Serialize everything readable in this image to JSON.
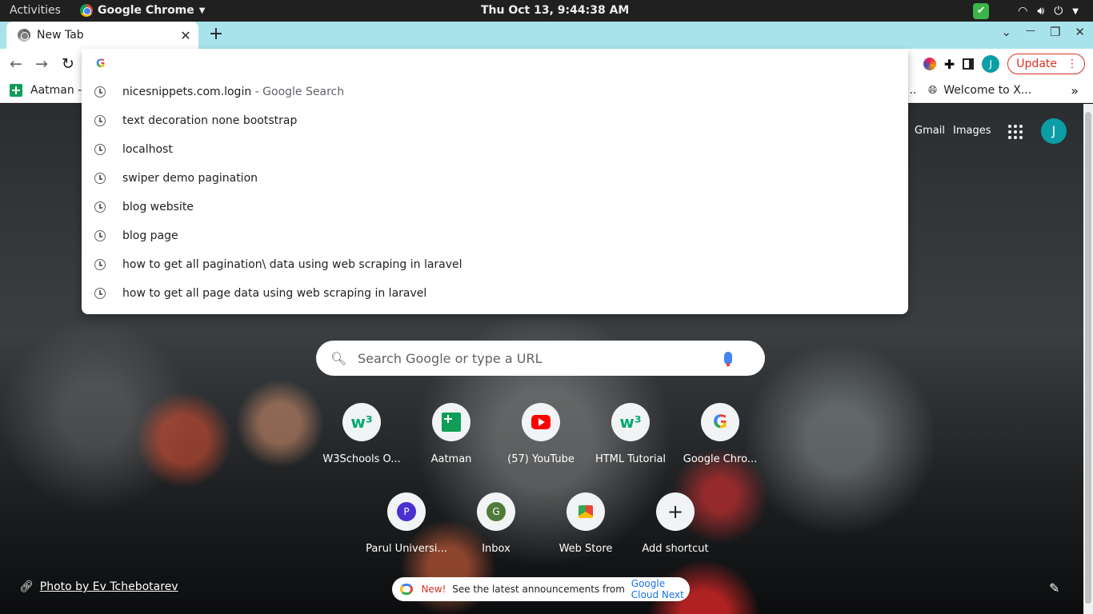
{
  "os_bar": {
    "activities": "Activities",
    "app_name": "Google Chrome",
    "clock": "Thu Oct 13,  9:44:38 AM"
  },
  "tab": {
    "title": "New Tab",
    "close": "✕",
    "new_tab": "+"
  },
  "window_controls": {
    "dropdown": "⌄",
    "minimize": "—",
    "restore": "❐",
    "close": "✕"
  },
  "toolbar": {
    "back": "←",
    "forward": "→",
    "reload": "↻",
    "update_label": "Update",
    "profile_initial": "J"
  },
  "bookmarks": {
    "first": "Aatman -",
    "second": "Welcome to X...",
    "ellipsis": "...",
    "more": "»"
  },
  "omnibox_dropdown": {
    "suggestions": [
      {
        "text": "nicesnippets.com.login",
        "suffix": " - Google Search"
      },
      {
        "text": "text decoration none bootstrap",
        "suffix": ""
      },
      {
        "text": "localhost",
        "suffix": ""
      },
      {
        "text": "swiper demo pagination",
        "suffix": ""
      },
      {
        "text": "blog website",
        "suffix": ""
      },
      {
        "text": "blog page",
        "suffix": ""
      },
      {
        "text": "how to get all pagination\\ data using web scraping in laravel",
        "suffix": ""
      },
      {
        "text": "how to get all page data using web scraping in laravel",
        "suffix": ""
      }
    ]
  },
  "ntp": {
    "gmail": "Gmail",
    "images": "Images",
    "avatar_initial": "J",
    "search_placeholder": "Search Google or type a URL",
    "shortcuts": [
      {
        "label": "W3Schools O...",
        "icon": "w3"
      },
      {
        "label": "Aatman",
        "icon": "sheets"
      },
      {
        "label": "(57) YouTube",
        "icon": "youtube"
      },
      {
        "label": "HTML Tutorial",
        "icon": "w3"
      },
      {
        "label": "Google Chro...",
        "icon": "google"
      },
      {
        "label": "Parul Universi...",
        "icon": "P"
      },
      {
        "label": "Inbox",
        "icon": "G"
      },
      {
        "label": "Web Store",
        "icon": "webstore"
      },
      {
        "label": "Add shortcut",
        "icon": "+"
      }
    ],
    "photo_credit": "Photo by Ev Tchebotarev",
    "promo": {
      "new": "New!",
      "text": " See the latest announcements from ",
      "link": "Google Cloud Next"
    }
  }
}
